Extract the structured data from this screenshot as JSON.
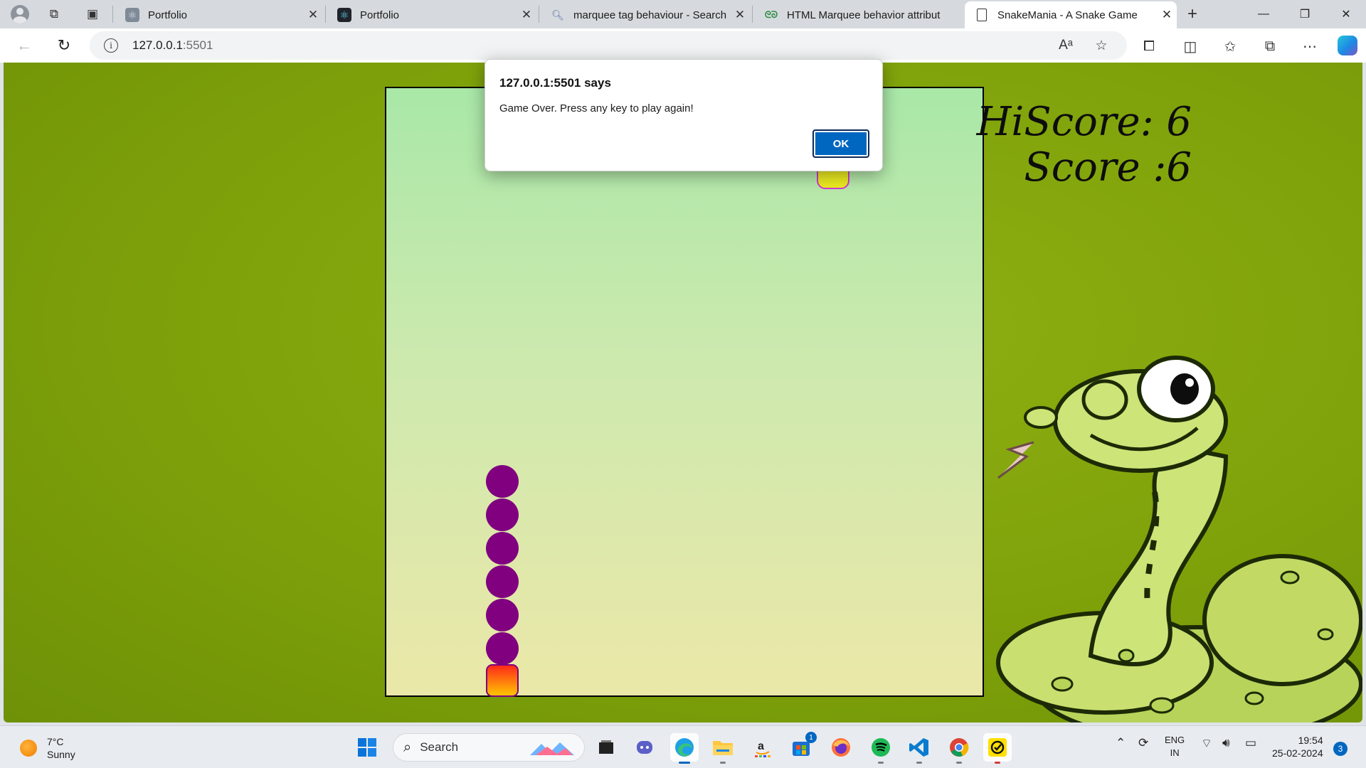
{
  "browser": {
    "tabs": [
      {
        "title": "Portfolio",
        "active": false
      },
      {
        "title": "Portfolio",
        "active": false
      },
      {
        "title": "marquee tag behaviour - Search",
        "active": false
      },
      {
        "title": "HTML Marquee behavior attribut",
        "active": false
      },
      {
        "title": "SnakeMania - A Snake Game",
        "active": true
      }
    ],
    "new_tab_label": "+",
    "address": {
      "host": "127.0.0.1",
      "port": ":5501"
    }
  },
  "game": {
    "hiscore_label": "HiScore: 6",
    "score_label": "Score :6",
    "snake_color": "#800080",
    "board_colors": [
      "#a9e8a8",
      "#ebe8a8"
    ]
  },
  "dialog": {
    "title": "127.0.0.1:5501 says",
    "message": "Game Over. Press any key to play again!",
    "ok_label": "OK"
  },
  "taskbar": {
    "weather": {
      "temp": "7°C",
      "condition": "Sunny"
    },
    "search_label": "Search",
    "store_badge": "1",
    "language": {
      "line1": "ENG",
      "line2": "IN"
    },
    "time": "19:54",
    "date": "25-02-2024",
    "notifications": "3"
  }
}
